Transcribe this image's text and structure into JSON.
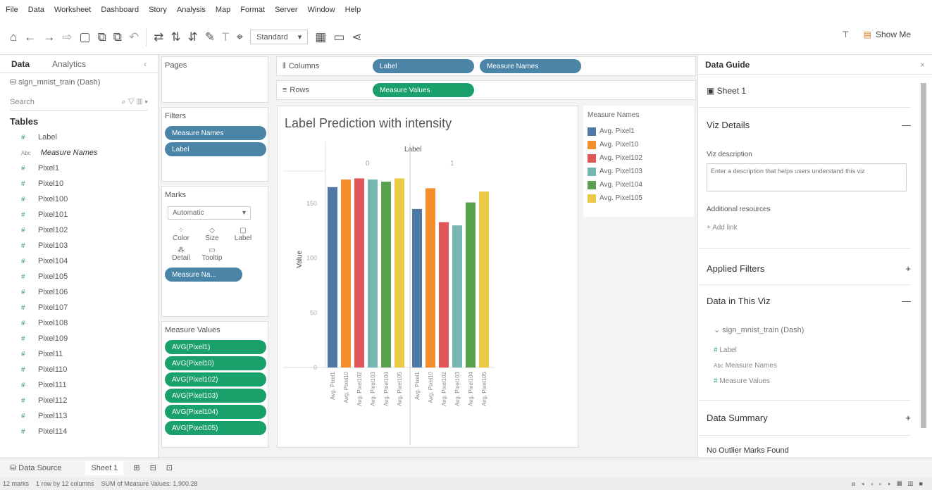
{
  "menu": [
    "File",
    "Data",
    "Worksheet",
    "Dashboard",
    "Story",
    "Analysis",
    "Map",
    "Format",
    "Server",
    "Window",
    "Help"
  ],
  "toolbar": {
    "standard_label": "Standard",
    "show_me": "Show Me"
  },
  "left": {
    "tab_data": "Data",
    "tab_analytics": "Analytics",
    "datasource": "sign_mnist_train (Dash)",
    "search_placeholder": "Search",
    "tables_label": "Tables",
    "fields": [
      "Label",
      "Measure Names",
      "Pixel1",
      "Pixel10",
      "Pixel100",
      "Pixel101",
      "Pixel102",
      "Pixel103",
      "Pixel104",
      "Pixel105",
      "Pixel106",
      "Pixel107",
      "Pixel108",
      "Pixel109",
      "Pixel11",
      "Pixel110",
      "Pixel111",
      "Pixel112",
      "Pixel113",
      "Pixel114"
    ]
  },
  "shelves": {
    "pages": "Pages",
    "filters": "Filters",
    "filter_pills": [
      "Measure Names",
      "Label"
    ],
    "marks": "Marks",
    "marks_type": "Automatic",
    "marks_buttons": [
      "Color",
      "Size",
      "Label",
      "Detail",
      "Tooltip"
    ],
    "marks_pill": "Measure Na...",
    "measure_values": "Measure Values",
    "mv_pills": [
      "AVG(Pixel1)",
      "AVG(Pixel10)",
      "AVG(Pixel102)",
      "AVG(Pixel103)",
      "AVG(Pixel104)",
      "AVG(Pixel105)"
    ],
    "columns": "Columns",
    "rows": "Rows",
    "col_pills": [
      "Label",
      "Measure Names"
    ],
    "row_pill": "Measure Values"
  },
  "chart_data": {
    "type": "bar",
    "title": "Label Prediction with intensity",
    "header_label": "Label",
    "ylabel": "Value",
    "ylim": [
      0,
      190
    ],
    "yticks": [
      0,
      50,
      100,
      150
    ],
    "panes": [
      {
        "label": "0",
        "categories": [
          "Avg. Pixel1",
          "Avg. Pixel10",
          "Avg. Pixel102",
          "Avg. Pixel103",
          "Avg. Pixel104",
          "Avg. Pixel105"
        ],
        "values": [
          165,
          172,
          173,
          172,
          170,
          173
        ]
      },
      {
        "label": "1",
        "categories": [
          "Avg. Pixel1",
          "Avg. Pixel10",
          "Avg. Pixel102",
          "Avg. Pixel103",
          "Avg. Pixel104",
          "Avg. Pixel105"
        ],
        "values": [
          145,
          164,
          133,
          130,
          151,
          161
        ]
      }
    ],
    "colors": [
      "#4e79a7",
      "#f28e2b",
      "#e15759",
      "#76b7b2",
      "#59a14f",
      "#edc948"
    ]
  },
  "legend": {
    "title": "Measure Names",
    "items": [
      "Avg. Pixel1",
      "Avg. Pixel10",
      "Avg. Pixel102",
      "Avg. Pixel103",
      "Avg. Pixel104",
      "Avg. Pixel105"
    ]
  },
  "right": {
    "title": "Data Guide",
    "sheet": "Sheet 1",
    "viz_details": "Viz Details",
    "viz_desc_label": "Viz description",
    "viz_desc_text": "Enter a description that helps users understand this viz",
    "additional": "Additional resources",
    "add_link": "Add link",
    "applied_filters": "Applied Filters",
    "data_in_viz": "Data in This Viz",
    "ds_name": "sign_mnist_train (Dash)",
    "ds_fields": [
      "Label",
      "Measure Names",
      "Measure Values"
    ],
    "data_summary": "Data Summary",
    "outliers": "No Outlier Marks Found"
  },
  "bottom": {
    "data_source": "Data Source",
    "sheet_tab": "Sheet 1"
  },
  "status": {
    "marks": "12 marks",
    "rows": "1 row by 12 columns",
    "sum": "SUM of Measure Values: 1,900.28"
  }
}
